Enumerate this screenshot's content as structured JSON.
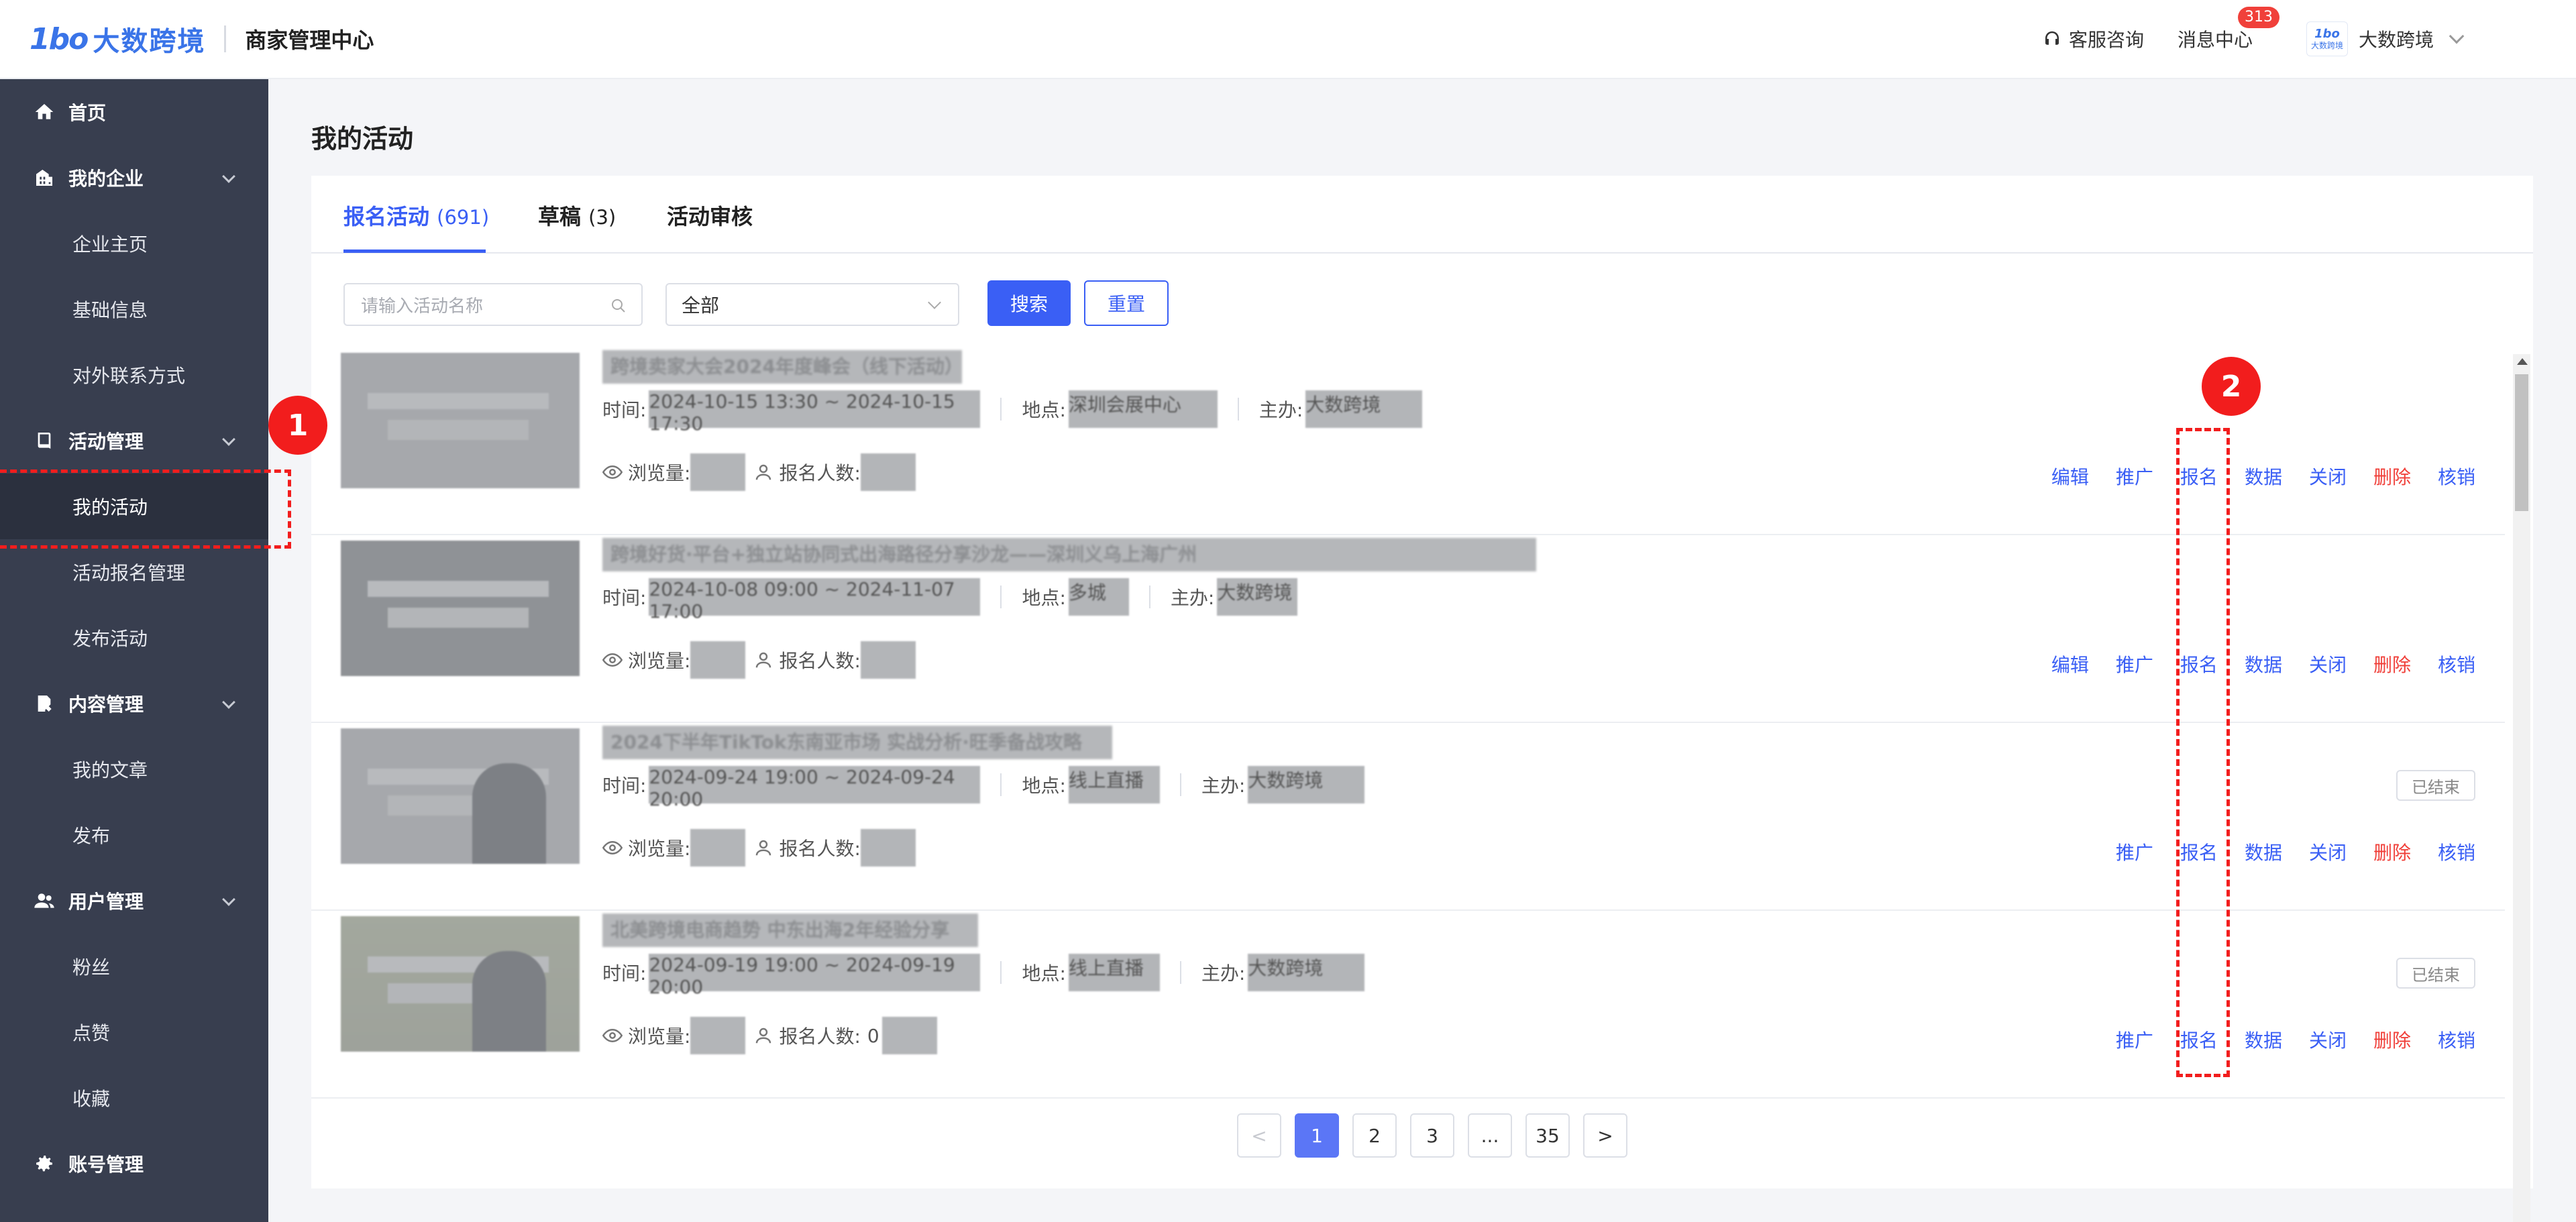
{
  "header": {
    "logo_mark": "1bo",
    "logo_text": "大数跨境",
    "center_title": "商家管理中心",
    "support": "客服咨询",
    "messages": "消息中心",
    "messages_badge": "313",
    "avatar_line1": "1bo",
    "avatar_line2": "大数跨境",
    "user_name": "大数跨境"
  },
  "sidebar": {
    "home": "首页",
    "my_company": "我的企业",
    "company_home": "企业主页",
    "basic_info": "基础信息",
    "contact": "对外联系方式",
    "activity_mgmt": "活动管理",
    "my_activities": "我的活动",
    "signup_mgmt": "活动报名管理",
    "publish_activity": "发布活动",
    "content_mgmt": "内容管理",
    "my_articles": "我的文章",
    "publish": "发布",
    "user_mgmt": "用户管理",
    "fans": "粉丝",
    "likes": "点赞",
    "favorites": "收藏",
    "account_mgmt": "账号管理"
  },
  "page_title": "我的活动",
  "tabs": {
    "signup": "报名活动",
    "signup_count": "(691)",
    "draft": "草稿",
    "draft_count": "(3)",
    "review": "活动审核"
  },
  "filters": {
    "search_placeholder": "请输入活动名称",
    "select_value": "全部",
    "search_btn": "搜索",
    "reset_btn": "重置"
  },
  "labels": {
    "time": "时间:",
    "location": "地点:",
    "host": "主办:",
    "views": "浏览量:",
    "signups": "报名人数:"
  },
  "rows": [
    {
      "title": "跨境卖家大会2024年度峰会（线下活动）",
      "time": "2024-10-15 13:30 ~ 2024-10-15 17:30",
      "location": "深圳会展中心",
      "host": "大数跨境",
      "actions": {
        "edit": "编辑",
        "promote": "推广",
        "signup": "报名",
        "data": "数据",
        "close": "关闭",
        "delete": "删除",
        "verify": "核销"
      }
    },
    {
      "title": "跨境好货·平台+独立站协同式出海路径分享沙龙——深圳义乌上海广州",
      "time": "2024-10-08 09:00 ~ 2024-11-07 17:00",
      "location": "多城",
      "host": "大数跨境",
      "actions": {
        "edit": "编辑",
        "promote": "推广",
        "signup": "报名",
        "data": "数据",
        "close": "关闭",
        "delete": "删除",
        "verify": "核销"
      }
    },
    {
      "title": "2024下半年TikTok东南亚市场 实战分析·旺季备战攻略",
      "time": "2024-09-24 19:00 ~ 2024-09-24 20:00",
      "location": "线上直播",
      "host": "大数跨境",
      "ended": "已结束",
      "actions": {
        "promote": "推广",
        "signup": "报名",
        "data": "数据",
        "close": "关闭",
        "delete": "删除",
        "verify": "核销"
      }
    },
    {
      "title": "北美跨境电商趋势 中东出海2年经验分享",
      "time": "2024-09-19 19:00 ~ 2024-09-19 20:00",
      "location": "线上直播",
      "host": "大数跨境",
      "ended": "已结束",
      "signup_prefix": "0",
      "actions": {
        "promote": "推广",
        "signup": "报名",
        "data": "数据",
        "close": "关闭",
        "delete": "删除",
        "verify": "核销"
      }
    }
  ],
  "pagination": {
    "prev": "<",
    "pages": [
      "1",
      "2",
      "3",
      "...",
      "35"
    ],
    "next": ">"
  },
  "annotations": {
    "marker1": "1",
    "marker2": "2"
  },
  "colors": {
    "primary": "#3a5ff5",
    "danger": "#f0403a",
    "sidebar_bg": "#383e4f",
    "annotation": "#f21d1d"
  }
}
